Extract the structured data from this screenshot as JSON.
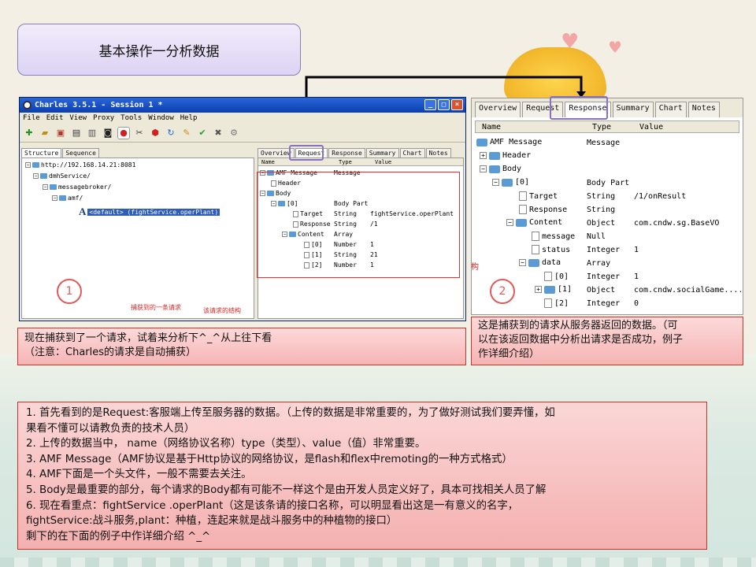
{
  "slide": {
    "title": "基本操作一分析数据"
  },
  "charles": {
    "window_title": "Charles 3.5.1 - Session 1 *",
    "window_buttons": [
      "_",
      "□",
      "×"
    ],
    "menu": [
      "File",
      "Edit",
      "View",
      "Proxy",
      "Tools",
      "Window",
      "Help"
    ],
    "left_tabs": [
      "Structure",
      "Sequence"
    ],
    "tree": {
      "host": "http://192.168.14.21:8081",
      "level1": "dmhService/",
      "level2": "messagebroker/",
      "level3": "amf/",
      "selected": "<default> (fightService.operPlant)"
    },
    "right_tabs": [
      "Overview",
      "Request",
      "Response",
      "Summary",
      "Chart",
      "Notes"
    ],
    "grid_headers": [
      "Name",
      "Type",
      "Value"
    ],
    "rows": [
      {
        "name": "AMF Message",
        "type": "Message",
        "value": ""
      },
      {
        "name": "Header",
        "type": "",
        "value": ""
      },
      {
        "name": "Body",
        "type": "",
        "value": ""
      },
      {
        "name": "[0]",
        "type": "Body Part",
        "value": ""
      },
      {
        "name": "Target",
        "type": "String",
        "value": "fightService.operPlant"
      },
      {
        "name": "Response",
        "type": "String",
        "value": "/1"
      },
      {
        "name": "Content",
        "type": "Array",
        "value": ""
      },
      {
        "name": "[0]",
        "type": "Number",
        "value": "1"
      },
      {
        "name": "[1]",
        "type": "String",
        "value": "21"
      },
      {
        "name": "[2]",
        "type": "Number",
        "value": "1"
      }
    ],
    "annotation_captured": "捕获到的一条请求",
    "annotation_structure": "该请求的结构"
  },
  "response_panel": {
    "tabs": [
      "Overview",
      "Request",
      "Response",
      "Summary",
      "Chart",
      "Notes"
    ],
    "grid_headers": [
      "Name",
      "Type",
      "Value"
    ],
    "rows": [
      {
        "name": "AMF Message",
        "type": "Message",
        "value": ""
      },
      {
        "name": "Header",
        "type": "",
        "value": ""
      },
      {
        "name": "Body",
        "type": "",
        "value": ""
      },
      {
        "name": "[0]",
        "type": "Body Part",
        "value": ""
      },
      {
        "name": "Target",
        "type": "String",
        "value": "/1/onResult"
      },
      {
        "name": "Response",
        "type": "String",
        "value": ""
      },
      {
        "name": "Content",
        "type": "Object",
        "value": "com.cndw.sg.BaseVO"
      },
      {
        "name": "message",
        "type": "Null",
        "value": ""
      },
      {
        "name": "status",
        "type": "Integer",
        "value": "1"
      },
      {
        "name": "data",
        "type": "Array",
        "value": ""
      },
      {
        "name": "[0]",
        "type": "Integer",
        "value": "1"
      },
      {
        "name": "[1]",
        "type": "Object",
        "value": "com.cndw.socialGame...."
      },
      {
        "name": "[2]",
        "type": "Integer",
        "value": "0"
      }
    ],
    "side_char": "构"
  },
  "markers": {
    "one": "1",
    "two": "2"
  },
  "notes": {
    "left_line1": "现在捕获到了一个请求，试着来分析下^_^从上往下看",
    "left_line2": "（注意：Charles的请求是自动捕获）",
    "right_line1": "这是捕获到的请求从服务器返回的数据。（可",
    "right_line2": "以在该返回数据中分析出请求是否成功，例子",
    "right_line3": "作详细介绍）",
    "main": [
      "1.          首先看到的是Request:客服端上传至服务器的数据。（上传的数据是非常重要的，为了做好测试我们要弄懂，如",
      "      果看不懂可以请教负责的技术人员）",
      "2.          上传的数据当中，  name（网络协议名称）type（类型）、value（值）非常重要。",
      "3.    AMF  Message（AMF协议是基于Http协议的网络协议，是flash和flex中remoting的一种方式格式）",
      "4.    AMF下面是一个头文件，一般不需要去关注。",
      "5.    Body是最重要的部分，每个请求的Body都有可能不一样这个是由开发人员定义好了，具本可找相关人员了解",
      "6.    现在看重点：fightService .operPlant（这是该条请的接口名称，可以明显看出这是一有意义的名字，",
      "fightService:战斗服务,plant：种植，连起来就是战斗服务中的种植物的接口）",
      "剩下的在下面的例子中作详细介绍  ^_^"
    ]
  }
}
